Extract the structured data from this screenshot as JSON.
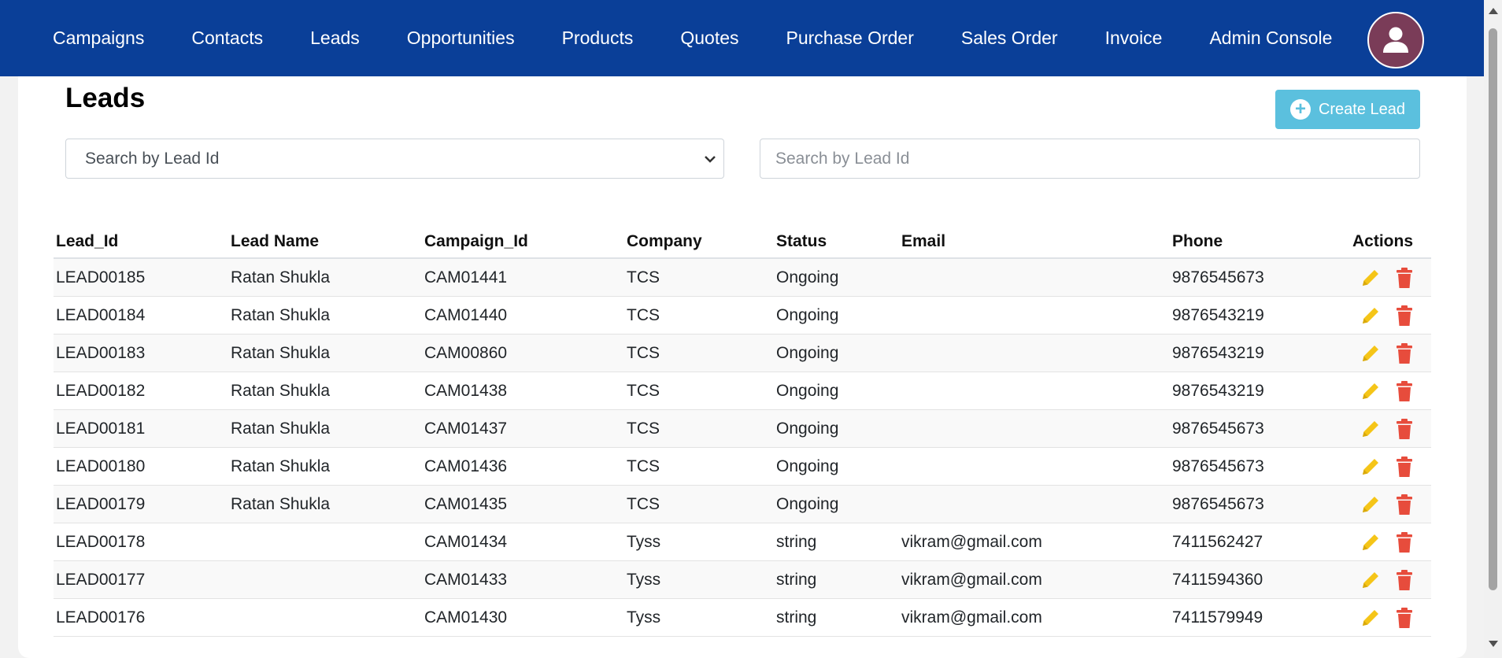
{
  "nav": {
    "items": [
      {
        "label": "Campaigns"
      },
      {
        "label": "Contacts"
      },
      {
        "label": "Leads"
      },
      {
        "label": "Opportunities"
      },
      {
        "label": "Products"
      },
      {
        "label": "Quotes"
      },
      {
        "label": "Purchase Order"
      },
      {
        "label": "Sales Order"
      },
      {
        "label": "Invoice"
      },
      {
        "label": "Admin Console"
      }
    ],
    "avatar_icon": "user-icon",
    "background": "#0a3f98"
  },
  "page": {
    "title": "Leads",
    "create_button": "Create Lead",
    "filter_select_value": "Search by Lead Id",
    "search_placeholder": "Search by Lead Id"
  },
  "table": {
    "headers": [
      "Lead_Id",
      "Lead Name",
      "Campaign_Id",
      "Company",
      "Status",
      "Email",
      "Phone",
      "Actions"
    ],
    "rows": [
      [
        "LEAD00185",
        "Ratan Shukla",
        "CAM01441",
        "TCS",
        "Ongoing",
        "",
        "9876545673"
      ],
      [
        "LEAD00184",
        "Ratan Shukla",
        "CAM01440",
        "TCS",
        "Ongoing",
        "",
        "9876543219"
      ],
      [
        "LEAD00183",
        "Ratan Shukla",
        "CAM00860",
        "TCS",
        "Ongoing",
        "",
        "9876543219"
      ],
      [
        "LEAD00182",
        "Ratan Shukla",
        "CAM01438",
        "TCS",
        "Ongoing",
        "",
        "9876543219"
      ],
      [
        "LEAD00181",
        "Ratan Shukla",
        "CAM01437",
        "TCS",
        "Ongoing",
        "",
        "9876545673"
      ],
      [
        "LEAD00180",
        "Ratan Shukla",
        "CAM01436",
        "TCS",
        "Ongoing",
        "",
        "9876545673"
      ],
      [
        "LEAD00179",
        "Ratan Shukla",
        "CAM01435",
        "TCS",
        "Ongoing",
        "",
        "9876545673"
      ],
      [
        "LEAD00178",
        "",
        "CAM01434",
        "Tyss",
        "string",
        "vikram@gmail.com",
        "7411562427"
      ],
      [
        "LEAD00177",
        "",
        "CAM01433",
        "Tyss",
        "string",
        "vikram@gmail.com",
        "7411594360"
      ],
      [
        "LEAD00176",
        "",
        "CAM01430",
        "Tyss",
        "string",
        "vikram@gmail.com",
        "7411579949"
      ]
    ],
    "action_icons": [
      "pencil-icon",
      "trash-icon"
    ]
  },
  "colors": {
    "edit": "#f5c518",
    "delete": "#e74c3c",
    "create_button": "#5bc0de"
  }
}
